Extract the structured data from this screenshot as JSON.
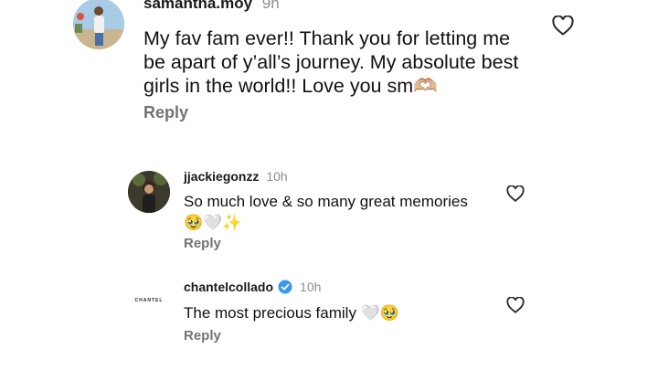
{
  "comments": [
    {
      "username": "samantha.moy",
      "time": "9h",
      "text_lines": [
        "My fav fam ever!! Thank you for letting me",
        "be apart of y’all’s journey. My absolute best",
        "girls in the world!! Love you sm🫶🏼"
      ],
      "reply_label": "Reply",
      "avatar_icon": "profile-photo"
    },
    {
      "username": "jjackiegonzz",
      "time": "10h",
      "text_lines": [
        "So much love & so many great memories",
        "🥹🤍✨"
      ],
      "reply_label": "Reply",
      "avatar_icon": "profile-photo"
    },
    {
      "username": "chantelcollado",
      "time": "10h",
      "verified": true,
      "text_lines": [
        "The most precious family 🤍🥹"
      ],
      "reply_label": "Reply",
      "avatar_text": "CHANTEL"
    }
  ],
  "icons": {
    "like": "heart-outline-icon",
    "verified": "verified-badge-icon"
  },
  "colors": {
    "verified_blue": "#3897f0",
    "secondary_text": "#8e8e8e",
    "reply_text": "#737373"
  }
}
